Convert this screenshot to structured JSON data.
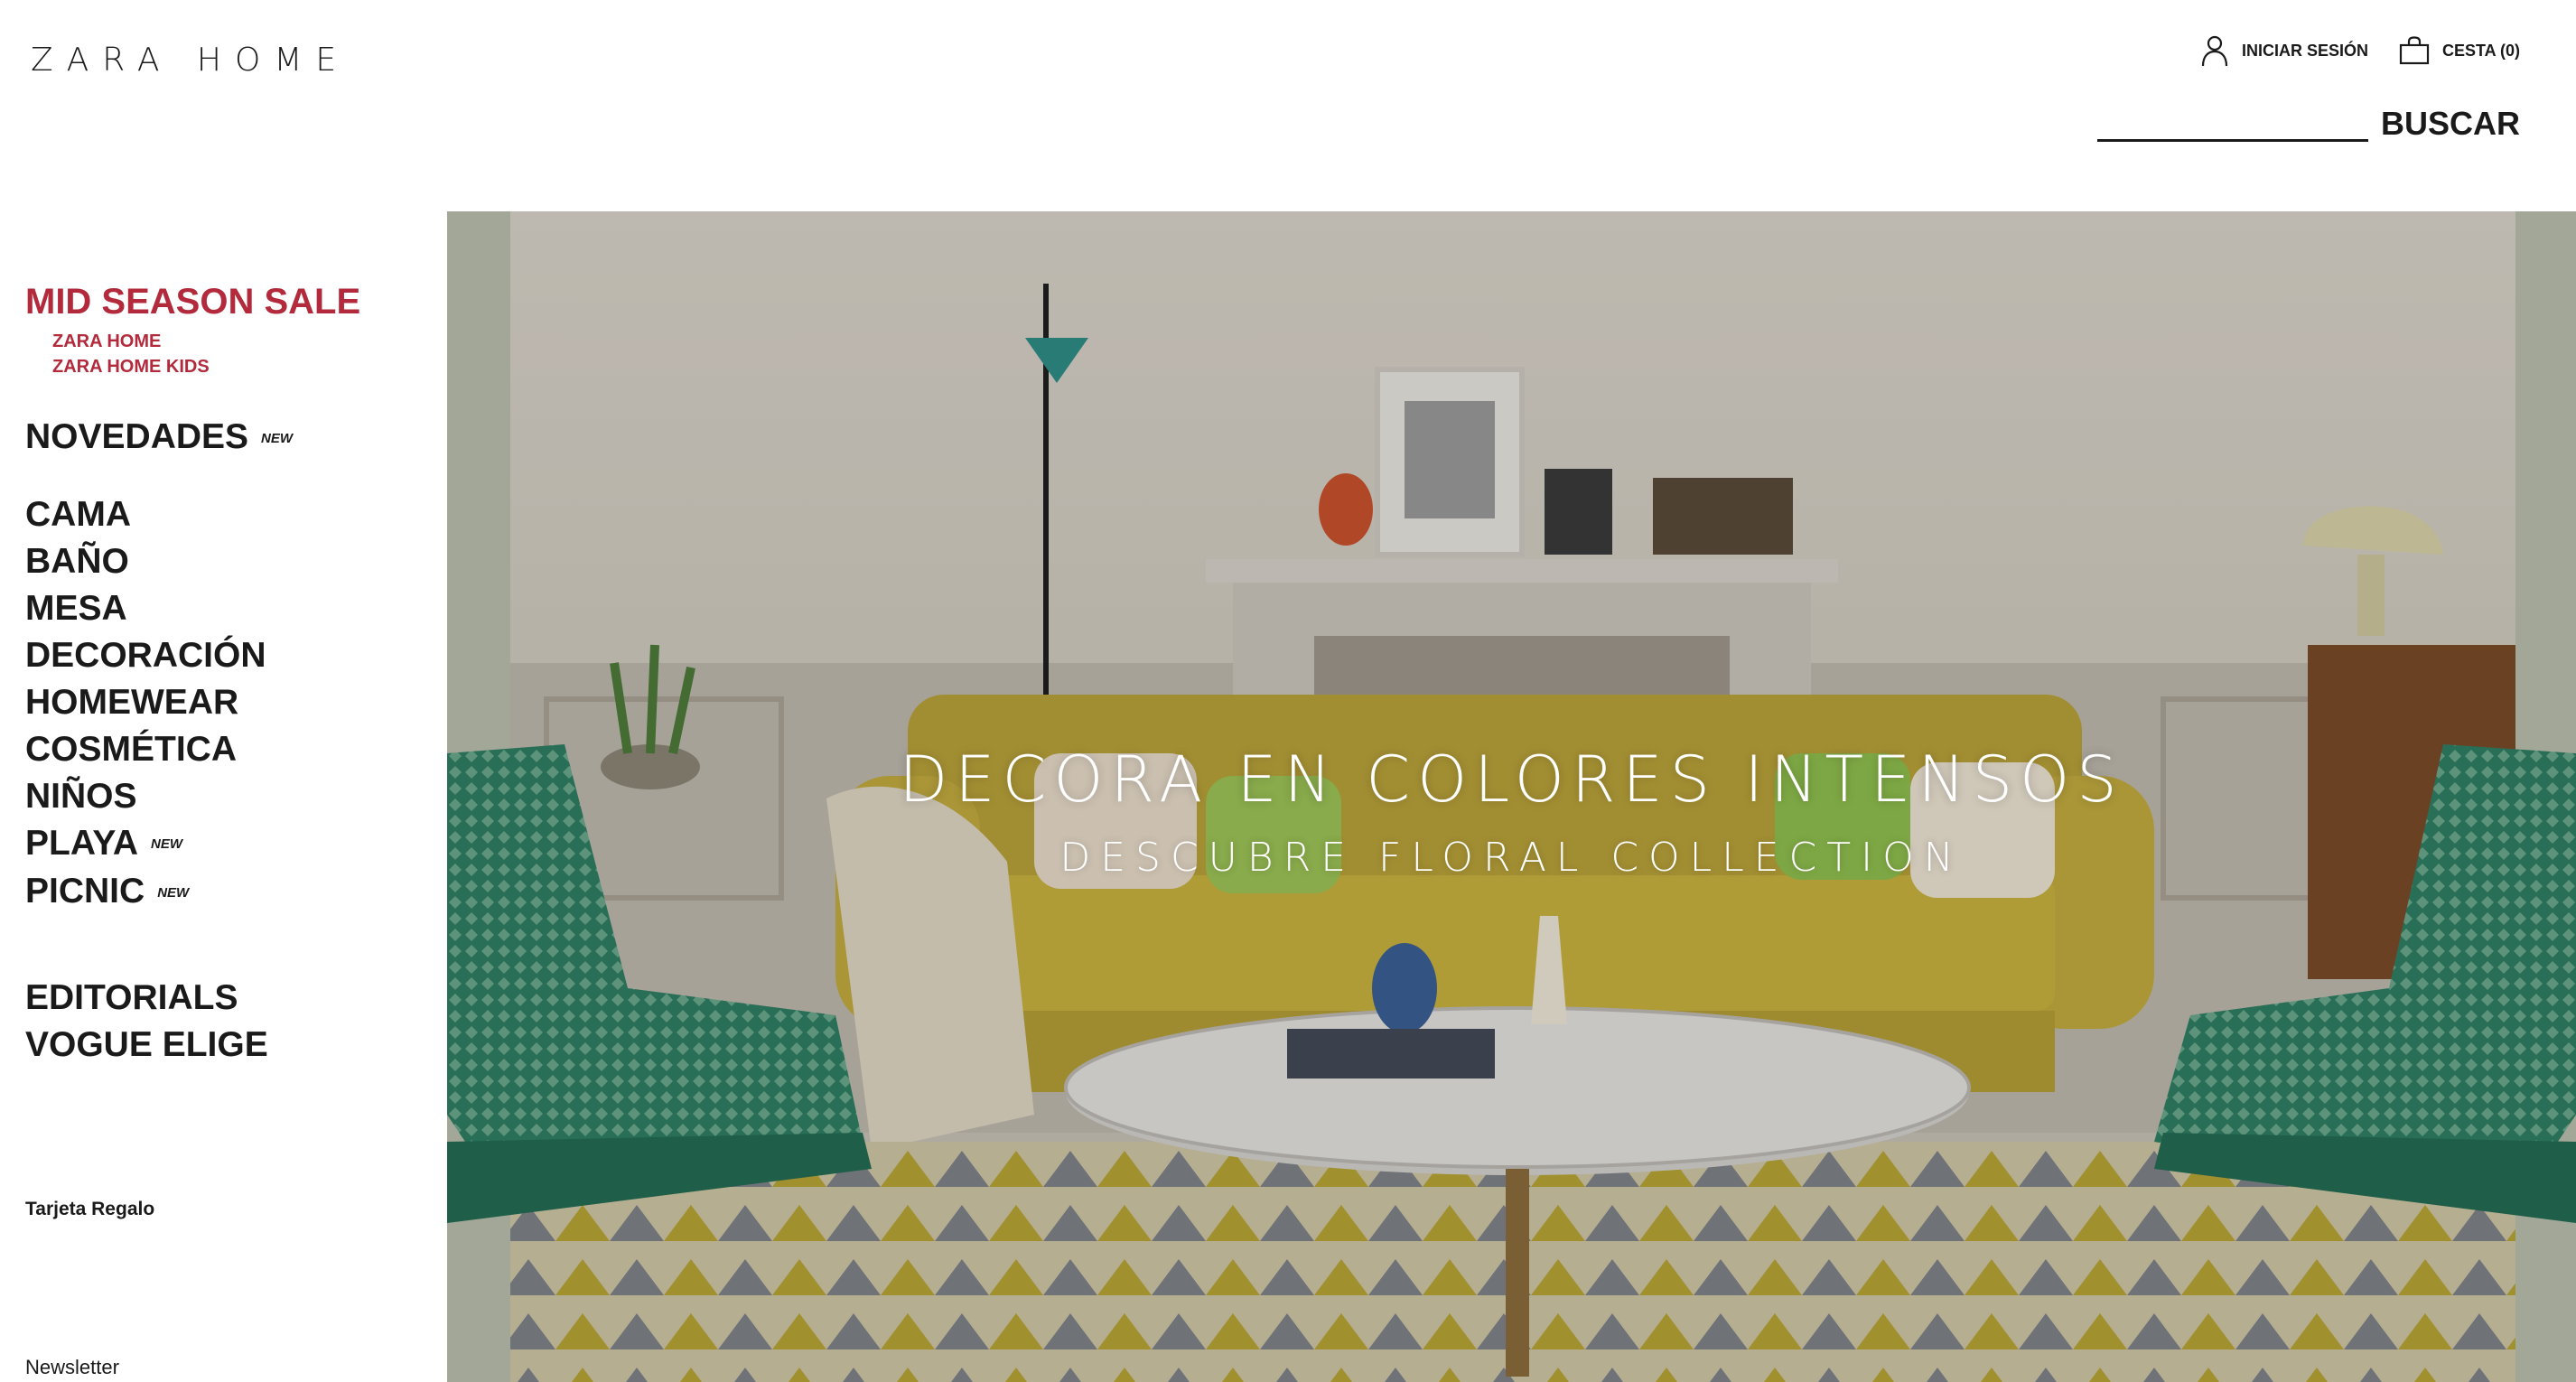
{
  "header": {
    "logo": "ZARA HOME",
    "login_label": "INICIAR SESIÓN",
    "cart_label": "CESTA (0)",
    "search_placeholder": "",
    "search_button": "BUSCAR"
  },
  "sidebar": {
    "sale": {
      "title": "MID SEASON SALE",
      "links": [
        "ZARA HOME",
        "ZARA HOME KIDS"
      ]
    },
    "novedades": {
      "label": "NOVEDADES",
      "badge": "NEW"
    },
    "categories": [
      {
        "label": "CAMA",
        "badge": ""
      },
      {
        "label": "BAÑO",
        "badge": ""
      },
      {
        "label": "MESA",
        "badge": ""
      },
      {
        "label": "DECORACIÓN",
        "badge": ""
      },
      {
        "label": "HOMEWEAR",
        "badge": ""
      },
      {
        "label": "COSMÉTICA",
        "badge": ""
      },
      {
        "label": "NIÑOS",
        "badge": ""
      },
      {
        "label": "PLAYA",
        "badge": "NEW"
      },
      {
        "label": "PICNIC",
        "badge": "NEW"
      }
    ],
    "editorial": [
      "EDITORIALS",
      "VOGUE ELIGE"
    ],
    "gift_card": "Tarjeta Regalo",
    "newsletter": "Newsletter"
  },
  "hero": {
    "title": "DECORA EN COLORES INTENSOS",
    "subtitle": "DESCUBRE FLORAL COLLECTION"
  },
  "colors": {
    "sale_red": "#b22a3c",
    "text": "#1a1a1a",
    "sofa_yellow": "#c9b23e",
    "chair_green": "#2f7f63"
  },
  "icons": {
    "login": "user-icon",
    "cart": "bag-icon"
  }
}
